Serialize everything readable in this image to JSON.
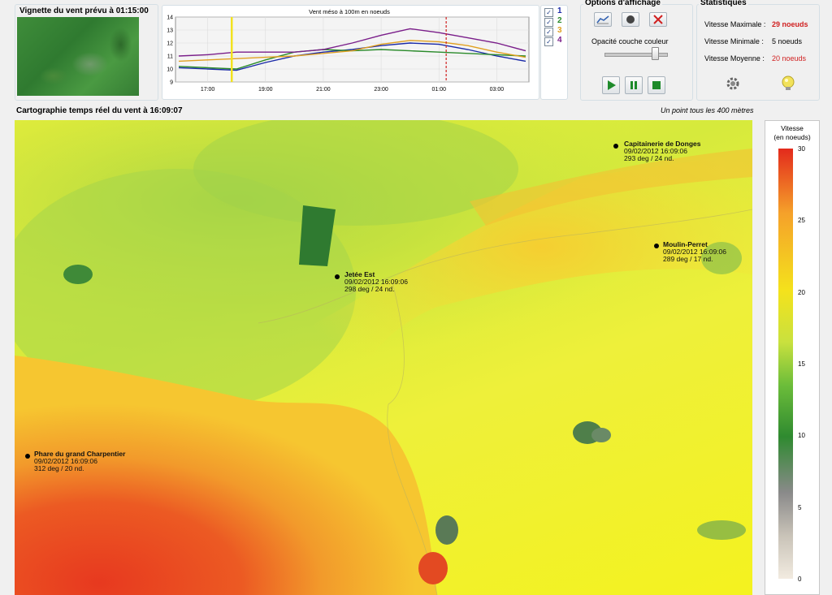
{
  "thumbnail": {
    "title": "Vignette du vent prévu à 01:15:00"
  },
  "mini_chart": {
    "title": "Vent méso à 100m en noeuds",
    "checkboxes": [
      {
        "num": "1",
        "color": "#1a2aa8"
      },
      {
        "num": "2",
        "color": "#2a8a2a"
      },
      {
        "num": "3",
        "color": "#e0a020"
      },
      {
        "num": "4",
        "color": "#7a1e8a"
      }
    ]
  },
  "chart_data": {
    "type": "line",
    "title": "Vent méso à 100m en noeuds",
    "x": [
      "16:00",
      "17:00",
      "18:00",
      "19:00",
      "20:00",
      "21:00",
      "22:00",
      "23:00",
      "00:00",
      "01:00",
      "02:00",
      "03:00",
      "04:00"
    ],
    "xticks": [
      "17:00",
      "19:00",
      "21:00",
      "23:00",
      "01:00",
      "03:00"
    ],
    "ylim": [
      9,
      14
    ],
    "yticks": [
      "14",
      "13",
      "12",
      "11",
      "10",
      "9"
    ],
    "series": [
      {
        "name": "1",
        "color": "#1a2aa8",
        "values": [
          10.1,
          10.0,
          9.9,
          10.5,
          11.0,
          11.3,
          11.5,
          11.8,
          12.0,
          11.9,
          11.5,
          11.0,
          10.6
        ]
      },
      {
        "name": "2",
        "color": "#2a8a2a",
        "values": [
          10.2,
          10.1,
          10.0,
          10.7,
          11.3,
          11.5,
          11.4,
          11.5,
          11.4,
          11.3,
          11.2,
          11.1,
          11.0
        ]
      },
      {
        "name": "3",
        "color": "#e0a020",
        "values": [
          10.6,
          10.7,
          10.8,
          10.9,
          11.0,
          11.2,
          11.4,
          11.9,
          12.2,
          12.1,
          11.8,
          11.3,
          10.9
        ]
      },
      {
        "name": "4",
        "color": "#7a1e8a",
        "values": [
          11.0,
          11.1,
          11.3,
          11.3,
          11.3,
          11.5,
          12.0,
          12.6,
          13.1,
          12.8,
          12.4,
          12.0,
          11.4
        ]
      }
    ],
    "current_time_marker": "17:50",
    "forecast_marker": "01:15"
  },
  "options": {
    "title": "Options d'affichage",
    "opacity_label": "Opacité couche couleur",
    "opacity_value": 0.8
  },
  "stats": {
    "title": "Statistiques",
    "max_label": "Vitesse Maximale :",
    "max_value": "29 noeuds",
    "min_label": "Vitesse Minimale :",
    "min_value": "5 noeuds",
    "avg_label": "Vitesse Moyenne :",
    "avg_value": "20 noeuds"
  },
  "map": {
    "title": "Cartographie temps réel du vent à 16:09:07",
    "resolution_note": "Un point tous les 400 mètres",
    "stations": [
      {
        "name": "Capitainerie de Donges",
        "time": "09/02/2012 16:09:06",
        "value": "293 deg / 24 nd."
      },
      {
        "name": "Moulin-Perret",
        "time": "09/02/2012 16:09:06",
        "value": "289 deg / 17 nd."
      },
      {
        "name": "Jetée Est",
        "time": "09/02/2012 16:09:06",
        "value": "298 deg / 24 nd."
      },
      {
        "name": "Phare du grand Charpentier",
        "time": "09/02/2012 16:09:06",
        "value": "312 deg / 20 nd."
      }
    ]
  },
  "legend": {
    "title_line1": "Vitesse",
    "title_line2": "(en noeuds)",
    "ticks": [
      "30",
      "25",
      "20",
      "15",
      "10",
      "5",
      "0"
    ]
  }
}
